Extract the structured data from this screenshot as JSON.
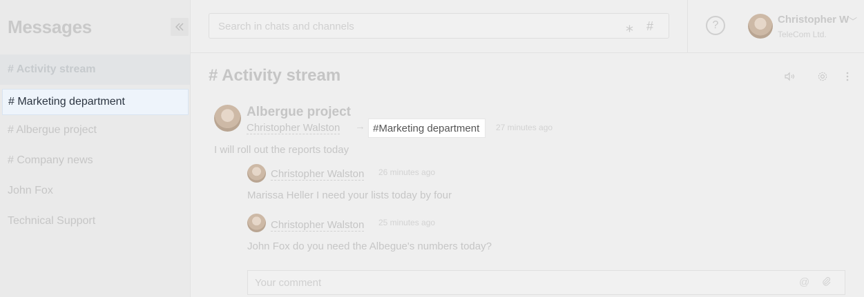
{
  "sidebar": {
    "title": "Messages",
    "channels": [
      {
        "label": "# Activity stream"
      },
      {
        "label": "# Marketing department"
      },
      {
        "label": "# Albergue project"
      },
      {
        "label": "# Company news"
      },
      {
        "label": "John Fox"
      },
      {
        "label": "Technical Support"
      }
    ]
  },
  "search": {
    "placeholder": "Search in chats and channels",
    "star_glyph": "⁎",
    "hash_glyph": "#"
  },
  "user": {
    "name": "Christopher W",
    "company": "TeleCom Ltd."
  },
  "main": {
    "title": "# Activity stream",
    "post": {
      "title": "Albergue project",
      "author": "Christopher Walston",
      "channel": "#Marketing department",
      "time": "27 minutes ago",
      "text": "I will roll out the reports today"
    },
    "comments": [
      {
        "author": "Christopher Walston",
        "time": "26 minutes ago",
        "text": "Marissa Heller I need your lists today by four"
      },
      {
        "author": "Christopher Walston",
        "time": "25 minutes ago",
        "text": "John Fox do you need the Albegue's numbers today?"
      }
    ],
    "comment_placeholder": "Your comment"
  },
  "icons": {
    "collapse": "double-chevron-left-icon",
    "help": "question-circle-icon",
    "mute": "speaker-icon",
    "settings": "gear-icon",
    "more": "kebab-icon",
    "mention": "at-icon",
    "attach": "paperclip-icon"
  }
}
